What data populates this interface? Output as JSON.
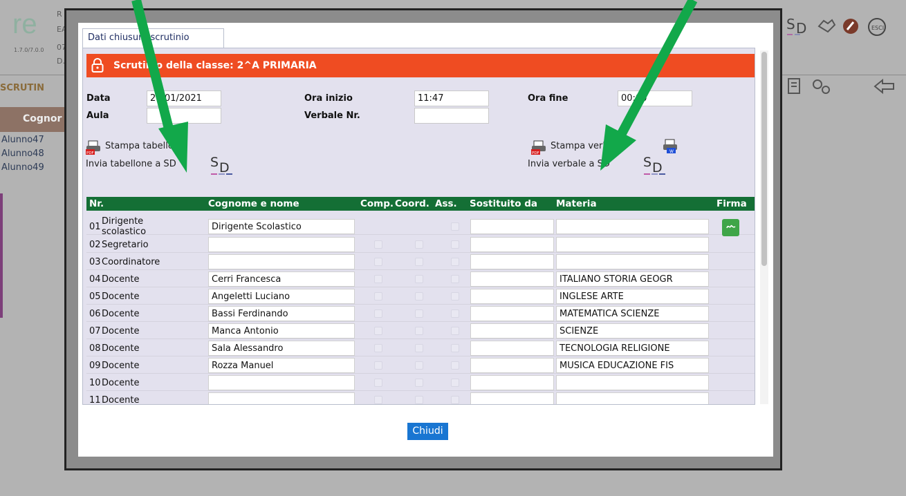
{
  "background": {
    "version": "1.7.0/7.0.0",
    "header_fragments": [
      "R",
      "EA",
      "07",
      "D."
    ],
    "section_label": "SCRUTIN",
    "column_header": "Cognor",
    "students": [
      "Alunno47",
      "Alunno48",
      "Alunno49"
    ]
  },
  "modal": {
    "tab_label": "Dati chiusura scrutinio",
    "title": "Scrutinio della classe: 2^A PRIMARIA",
    "fields": {
      "data_label": "Data",
      "data_value": "26/01/2021",
      "ora_inizio_label": "Ora inizio",
      "ora_inizio_value": "11:47",
      "ora_fine_label": "Ora fine",
      "ora_fine_value": "00:00",
      "aula_label": "Aula",
      "aula_value": "",
      "verbale_label": "Verbale Nr.",
      "verbale_value": ""
    },
    "actions": {
      "stampa_tabellone": "Stampa tabellone",
      "invia_tabellone": "Invia tabellone a SD",
      "stampa_verbale": "Stampa verbale",
      "invia_verbale": "Invia verbale a SD"
    },
    "table": {
      "headers": {
        "nr": "Nr.",
        "nome": "Cognome e nome",
        "comp": "Comp.",
        "coord": "Coord.",
        "ass": "Ass.",
        "sostituito": "Sostituito da",
        "materia": "Materia",
        "firma": "Firma"
      },
      "rows": [
        {
          "nr": "01",
          "role": "Dirigente scolastico",
          "name": "Dirigente Scolastico",
          "materia": ""
        },
        {
          "nr": "02",
          "role": "Segretario",
          "name": "",
          "materia": ""
        },
        {
          "nr": "03",
          "role": "Coordinatore",
          "name": "",
          "materia": ""
        },
        {
          "nr": "04",
          "role": "Docente",
          "name": "Cerri Francesca",
          "materia": "ITALIANO STORIA GEOGR"
        },
        {
          "nr": "05",
          "role": "Docente",
          "name": "Angeletti Luciano",
          "materia": "INGLESE ARTE"
        },
        {
          "nr": "06",
          "role": "Docente",
          "name": "Bassi Ferdinando",
          "materia": "MATEMATICA SCIENZE"
        },
        {
          "nr": "07",
          "role": "Docente",
          "name": "Manca Antonio",
          "materia": "SCIENZE"
        },
        {
          "nr": "08",
          "role": "Docente",
          "name": "Sala Alessandro",
          "materia": "TECNOLOGIA RELIGIONE"
        },
        {
          "nr": "09",
          "role": "Docente",
          "name": "Rozza Manuel",
          "materia": "MUSICA EDUCAZIONE FIS"
        },
        {
          "nr": "10",
          "role": "Docente",
          "name": "",
          "materia": ""
        },
        {
          "nr": "11",
          "role": "Docente",
          "name": "",
          "materia": ""
        }
      ]
    },
    "close_label": "Chiudi"
  },
  "colors": {
    "title_bar": "#ef4c22",
    "table_header": "#146f35",
    "close_button": "#1976d2",
    "arrow": "#12a84a",
    "pane_bg": "#e3e1ee"
  },
  "icons": [
    "lock-icon",
    "pdf-icon",
    "word-icon",
    "sd-logo-icon",
    "signature-icon",
    "settings-icon",
    "back-arrow-icon",
    "exit-icon"
  ]
}
